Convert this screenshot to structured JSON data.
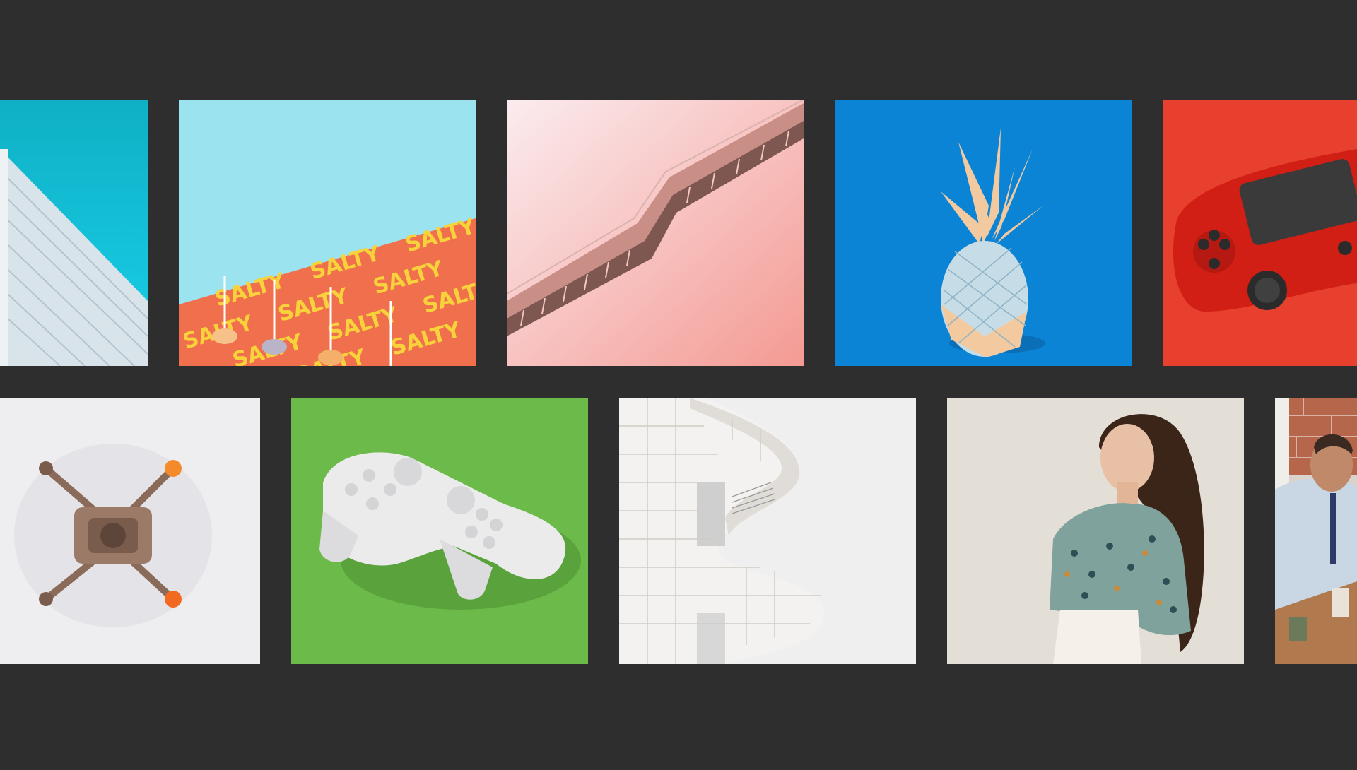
{
  "gallery": {
    "rows": [
      {
        "tiles": [
          {
            "subject": "white-building-cyan-sky"
          },
          {
            "subject": "salty-wall",
            "sign_text": "SALTY"
          },
          {
            "subject": "pink-staircase"
          },
          {
            "subject": "pineapple-blue"
          },
          {
            "subject": "red-gamepad"
          }
        ]
      },
      {
        "tiles": [
          {
            "subject": "drone-top-view"
          },
          {
            "subject": "white-gamepad-green"
          },
          {
            "subject": "white-architecture"
          },
          {
            "subject": "woman-floral-top"
          },
          {
            "subject": "man-office"
          }
        ]
      }
    ]
  },
  "colors": {
    "background": "#2e2e2e",
    "cyan_sky": "#15c5e0",
    "salty_wall": "#f0704d",
    "salty_sky": "#9be3ee",
    "salty_letters": "#f7d23a",
    "pink_wall": "#f6a6a0",
    "pineapple_blue": "#0b84d6",
    "gamepad_red_bg": "#e8402e",
    "green_bg": "#6cbb4a",
    "beige_bg": "#e4dfd6"
  }
}
